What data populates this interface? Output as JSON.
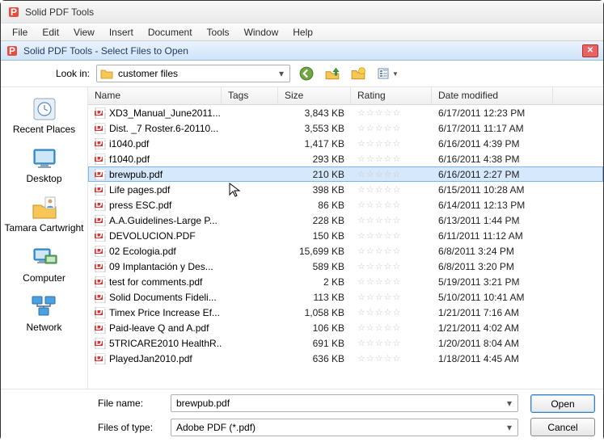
{
  "app": {
    "title": "Solid PDF Tools",
    "dialog_title": "Solid PDF Tools    - Select Files to Open"
  },
  "menu": [
    "File",
    "Edit",
    "View",
    "Insert",
    "Document",
    "Tools",
    "Window",
    "Help"
  ],
  "lookin": {
    "label": "Look in:",
    "value": "customer files"
  },
  "places": [
    {
      "key": "recent",
      "label": "Recent Places"
    },
    {
      "key": "desktop",
      "label": "Desktop"
    },
    {
      "key": "user",
      "label": "Tamara Cartwright"
    },
    {
      "key": "computer",
      "label": "Computer"
    },
    {
      "key": "network",
      "label": "Network"
    }
  ],
  "columns": {
    "name": "Name",
    "tags": "Tags",
    "size": "Size",
    "rating": "Rating",
    "date": "Date modified"
  },
  "files": [
    {
      "name": "XD3_Manual_June2011...",
      "size": "3,843 KB",
      "date": "6/17/2011 12:23 PM",
      "sel": false
    },
    {
      "name": "Dist. _7 Roster.6-20110...",
      "size": "3,553 KB",
      "date": "6/17/2011 11:17 AM",
      "sel": false
    },
    {
      "name": "i1040.pdf",
      "size": "1,417 KB",
      "date": "6/16/2011 4:39 PM",
      "sel": false
    },
    {
      "name": "f1040.pdf",
      "size": "293 KB",
      "date": "6/16/2011 4:38 PM",
      "sel": false
    },
    {
      "name": "brewpub.pdf",
      "size": "210 KB",
      "date": "6/16/2011 2:27 PM",
      "sel": true
    },
    {
      "name": "Life pages.pdf",
      "size": "398 KB",
      "date": "6/15/2011 10:28 AM",
      "sel": false
    },
    {
      "name": "press ESC.pdf",
      "size": "86 KB",
      "date": "6/14/2011 12:13 PM",
      "sel": false
    },
    {
      "name": "A.A.Guidelines-Large P...",
      "size": "228 KB",
      "date": "6/13/2011 1:44 PM",
      "sel": false
    },
    {
      "name": "DEVOLUCION.PDF",
      "size": "150 KB",
      "date": "6/11/2011 11:12 AM",
      "sel": false
    },
    {
      "name": "02 Ecologia.pdf",
      "size": "15,699 KB",
      "date": "6/8/2011 3:24 PM",
      "sel": false
    },
    {
      "name": "09 Implantación y Des...",
      "size": "589 KB",
      "date": "6/8/2011 3:20 PM",
      "sel": false
    },
    {
      "name": "test for comments.pdf",
      "size": "2 KB",
      "date": "5/19/2011 3:21 PM",
      "sel": false
    },
    {
      "name": "Solid Documents Fideli...",
      "size": "113 KB",
      "date": "5/10/2011 10:41 AM",
      "sel": false
    },
    {
      "name": "Timex Price Increase Ef...",
      "size": "1,058 KB",
      "date": "1/21/2011 7:16 AM",
      "sel": false
    },
    {
      "name": "Paid-leave Q and A.pdf",
      "size": "106 KB",
      "date": "1/21/2011 4:02 AM",
      "sel": false
    },
    {
      "name": "5TRICARE2010 HealthR...",
      "size": "691 KB",
      "date": "1/20/2011 8:04 AM",
      "sel": false
    },
    {
      "name": "PlayedJan2010.pdf",
      "size": "636 KB",
      "date": "1/18/2011 4:45 AM",
      "sel": false
    }
  ],
  "filename": {
    "label": "File name:",
    "value": "brewpub.pdf"
  },
  "filter": {
    "label": "Files of type:",
    "value": "Adobe PDF (*.pdf)"
  },
  "buttons": {
    "open": "Open",
    "cancel": "Cancel"
  },
  "stars": "☆☆☆☆☆"
}
